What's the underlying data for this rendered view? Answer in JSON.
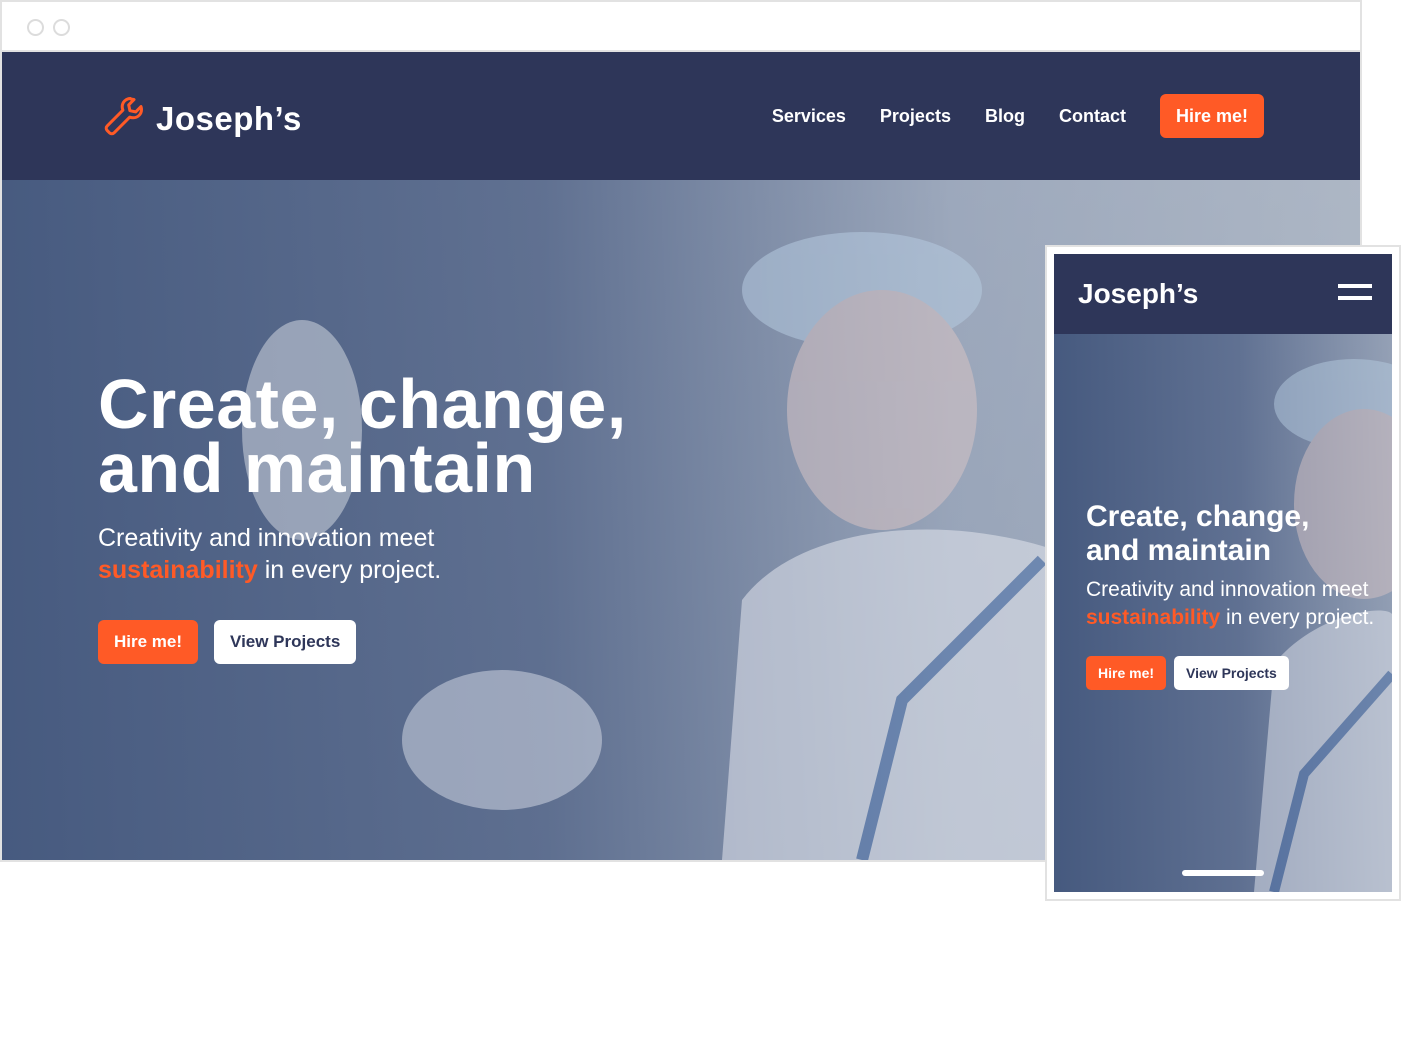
{
  "desktop": {
    "browser": {
      "window_controls": [
        "close-dot",
        "minimize-dot"
      ]
    },
    "header": {
      "logo_icon": "wrench-icon",
      "logo_text": "Joseph’s",
      "nav": [
        {
          "label": "Services"
        },
        {
          "label": "Projects"
        },
        {
          "label": "Blog"
        },
        {
          "label": "Contact"
        }
      ],
      "cta_label": "Hire me!"
    },
    "hero": {
      "title_line1": "Create, change,",
      "title_line2": "and maintain",
      "subtitle_before": "Creativity and innovation meet",
      "subtitle_accent": "sustainability",
      "subtitle_after": " in every project.",
      "primary_button": "Hire me!",
      "secondary_button": "View Projects"
    }
  },
  "mobile": {
    "header": {
      "logo_text": "Joseph’s",
      "menu_icon": "hamburger-menu-icon"
    },
    "hero": {
      "title_line1": "Create, change,",
      "title_line2": "and maintain",
      "subtitle_before": "Creativity and innovation meet ",
      "subtitle_accent": "sustainability",
      "subtitle_after": " in every project.",
      "primary_button": "Hire me!",
      "secondary_button": "View Projects"
    }
  },
  "colors": {
    "navy": "#2e3659",
    "accent_orange": "#ff5a26",
    "white": "#ffffff",
    "frame_border": "#e2e2e2"
  }
}
